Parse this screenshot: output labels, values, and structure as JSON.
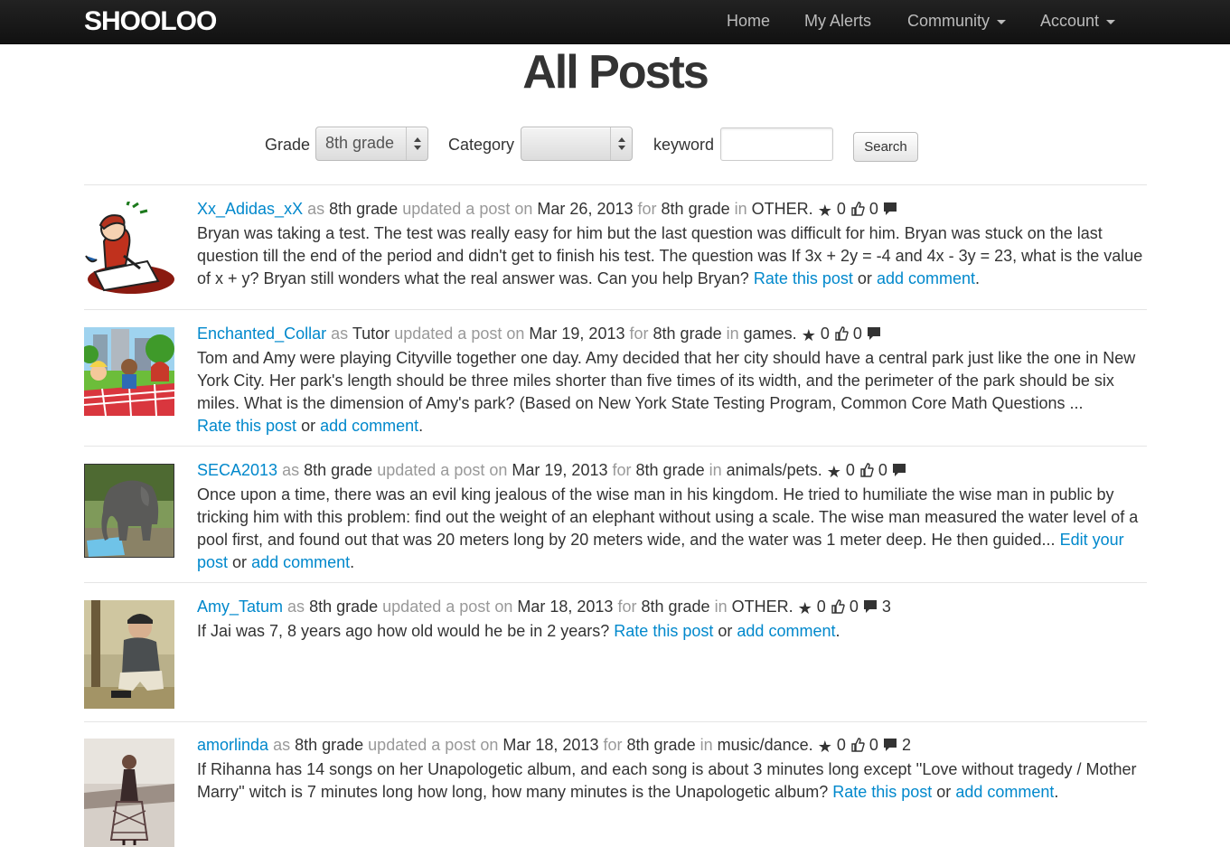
{
  "brand": "SHOOLOO",
  "nav": {
    "home": "Home",
    "alerts": "My Alerts",
    "community": "Community",
    "account": "Account"
  },
  "page_title": "All Posts",
  "filters": {
    "grade_label": "Grade",
    "grade_value": "8th grade",
    "category_label": "Category",
    "category_value": "",
    "keyword_label": "keyword",
    "keyword_value": "",
    "search_label": "Search"
  },
  "words": {
    "as": "as",
    "updated": "updated",
    "a": "a",
    "post": "post",
    "on": "on",
    "for": "for",
    "in": "in",
    "or": "or"
  },
  "colors": {
    "link": "#0088cc",
    "muted": "#999999",
    "navbar": "#1b1b1b"
  },
  "posts": [
    {
      "author": "Xx_Adidas_xX",
      "role": "8th grade",
      "date": "Mar 26, 2013",
      "grade": "8th grade",
      "category": "OTHER.",
      "stars": "0",
      "likes": "0",
      "comments": "",
      "body": "Bryan was taking a test. The test was really easy for him but the last question was difficult for him. Bryan was stuck on the last question till the end of the period and didn't get to finish his test. The question was If 3x + 2y = -4 and 4x - 3y = 23, what is the value of x + y? Bryan still wonders what the real answer was. Can you help Bryan?",
      "action": "Rate this post",
      "comment_link": "add comment",
      "avatar": "student-writing-cartoon"
    },
    {
      "author": "Enchanted_Collar",
      "role": "Tutor",
      "date": "Mar 19, 2013",
      "grade": "8th grade",
      "category": "games.",
      "stars": "0",
      "likes": "0",
      "comments": "",
      "body": "Tom and Amy were playing Cityville together one day. Amy decided that her city should have a central park just like the one in New York City. Her park's length should be three miles shorter than five times of its width, and the perimeter of the park should be six miles. What is the dimension of Amy's park? (Based on New York State Testing Program, Common Core Math Questions ...",
      "action": "Rate this post",
      "comment_link": "add comment",
      "avatar": "cityville-picnic"
    },
    {
      "author": "SECA2013",
      "role": "8th grade",
      "date": "Mar 19, 2013",
      "grade": "8th grade",
      "category": "animals/pets.",
      "stars": "0",
      "likes": "0",
      "comments": "",
      "body": "Once upon a time, there was an evil king jealous of the wise man in his kingdom. He tried to humiliate the wise man in public by tricking him with this problem: find out the weight of an elephant without using a scale. The wise man measured the water level of a pool first, and found out that was 20 meters long by 20 meters wide, and the water was 1 meter deep. He then guided...",
      "action": "Edit your post",
      "comment_link": "add comment",
      "avatar": "elephant-by-pool"
    },
    {
      "author": "Amy_Tatum",
      "role": "8th grade",
      "date": "Mar 18, 2013",
      "grade": "8th grade",
      "category": "OTHER.",
      "stars": "0",
      "likes": "0",
      "comments": "3",
      "body": "If Jai was 7, 8 years ago how old would he be in 2 years?",
      "action": "Rate this post",
      "comment_link": "add comment",
      "avatar": "man-crouching-photo"
    },
    {
      "author": "amorlinda",
      "role": "8th grade",
      "date": "Mar 18, 2013",
      "grade": "8th grade",
      "category": "music/dance.",
      "stars": "0",
      "likes": "0",
      "comments": "2",
      "body": "If Rihanna has 14 songs on her Unapologetic album, and each song is about 3 minutes long except ''Love without tragedy / Mother Marry'' witch is 7 minutes long how long, how many minutes is the Unapologetic album?",
      "action": "Rate this post",
      "comment_link": "add comment",
      "avatar": "album-cover"
    }
  ]
}
